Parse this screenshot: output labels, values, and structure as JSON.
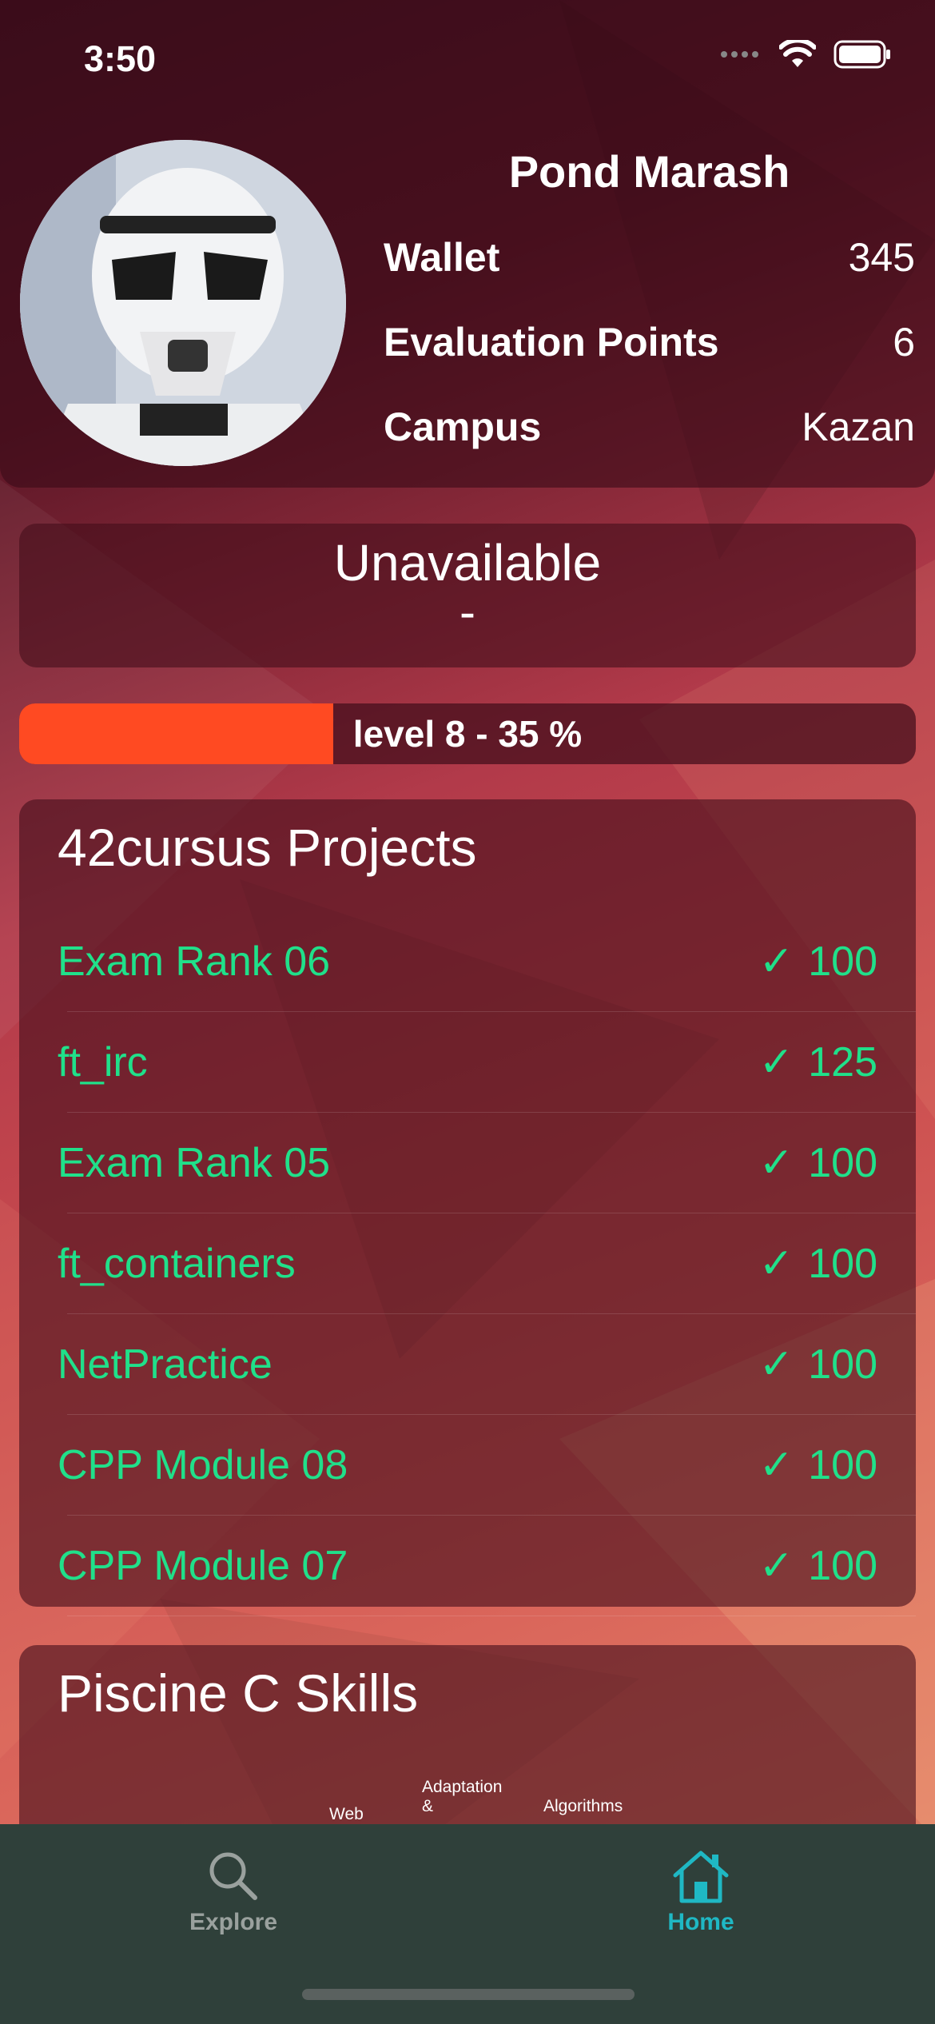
{
  "status_bar": {
    "time": "3:50"
  },
  "profile": {
    "name": "Pond Marash",
    "stats": [
      {
        "label": "Wallet",
        "value": "345"
      },
      {
        "label": "Evaluation Points",
        "value": "6"
      },
      {
        "label": "Campus",
        "value": "Kazan"
      }
    ]
  },
  "location": {
    "status": "Unavailable",
    "place": "-"
  },
  "level": {
    "text": "level 8 - 35 %",
    "progress_percent": 35
  },
  "projects": {
    "title": "42cursus Projects",
    "items": [
      {
        "name": "Exam Rank 06",
        "score": "100"
      },
      {
        "name": "ft_irc",
        "score": "125"
      },
      {
        "name": "Exam Rank 05",
        "score": "100"
      },
      {
        "name": "ft_containers",
        "score": "100"
      },
      {
        "name": "NetPractice",
        "score": "100"
      },
      {
        "name": "CPP Module 08",
        "score": "100"
      },
      {
        "name": "CPP Module 07",
        "score": "100"
      }
    ]
  },
  "skills": {
    "title": "Piscine C Skills",
    "labels": [
      "Web",
      "Adaptation",
      "&",
      "Algorithms"
    ]
  },
  "tabbar": {
    "explore_label": "Explore",
    "home_label": "Home",
    "active_color": "#1fb8c4",
    "inactive_color": "#9aa19e"
  },
  "colors": {
    "success": "#20e08a",
    "level_fill": "#ff4a22"
  }
}
